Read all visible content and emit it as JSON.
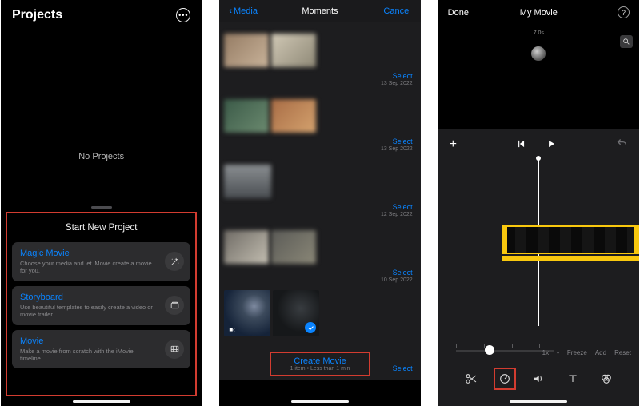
{
  "phone1": {
    "title": "Projects",
    "empty_label": "No Projects",
    "sheet_title": "Start New Project",
    "cards": [
      {
        "title": "Magic Movie",
        "desc": "Choose your media and let iMovie create a movie for you.",
        "icon": "magic-wand"
      },
      {
        "title": "Storyboard",
        "desc": "Use beautiful templates to easily create a video or movie trailer.",
        "icon": "storyboard"
      },
      {
        "title": "Movie",
        "desc": "Make a movie from scratch with the iMovie timeline.",
        "icon": "film"
      }
    ]
  },
  "phone2": {
    "back_label": "Media",
    "title": "Moments",
    "cancel_label": "Cancel",
    "groups": [
      {
        "select": "Select",
        "date": "13 Sep 2022"
      },
      {
        "select": "Select",
        "date": "13 Sep 2022"
      },
      {
        "select": "Select",
        "date": "12 Sep 2022"
      },
      {
        "select": "Select",
        "date": "10 Sep 2022"
      },
      {
        "select": "Select",
        "date": ""
      }
    ],
    "create_label": "Create Movie",
    "create_sub": "1 item • Less than 1 min"
  },
  "phone3": {
    "done_label": "Done",
    "title": "My Movie",
    "timestamp": "7.0s",
    "speed": {
      "current": "1x",
      "freeze": "Freeze",
      "add": "Add",
      "reset": "Reset"
    },
    "bullet": "•",
    "accent": "#f9c80e",
    "highlight_red": "#d23c30",
    "link_blue": "#0a84ff"
  }
}
